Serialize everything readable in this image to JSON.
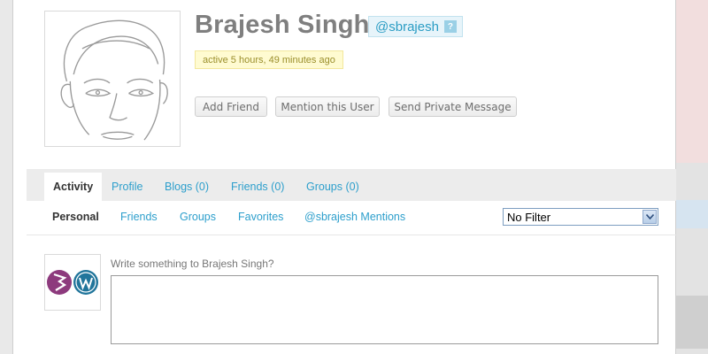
{
  "profile": {
    "name": "Brajesh Singh",
    "handle": "@sbrajesh",
    "handle_help": "?",
    "activity": "active 5 hours, 49 minutes ago"
  },
  "actions": {
    "add_friend": "Add Friend",
    "mention": "Mention this User",
    "private_message": "Send Private Message"
  },
  "tabs": [
    {
      "label": "Activity",
      "selected": true
    },
    {
      "label": "Profile"
    },
    {
      "label": "Blogs (0)"
    },
    {
      "label": "Friends (0)"
    },
    {
      "label": "Groups (0)"
    }
  ],
  "subnav": [
    {
      "label": "Personal",
      "selected": true
    },
    {
      "label": "Friends"
    },
    {
      "label": "Groups"
    },
    {
      "label": "Favorites"
    },
    {
      "label": "@sbrajesh Mentions"
    }
  ],
  "filter": {
    "selected": "No Filter"
  },
  "post_form": {
    "label": "Write something to Brajesh Singh?",
    "value": ""
  },
  "colors": {
    "link": "#2d9fcc",
    "name": "#7f7f7f",
    "activity_bg": "#fffbd1",
    "handle_bg": "#e7f4fa"
  }
}
